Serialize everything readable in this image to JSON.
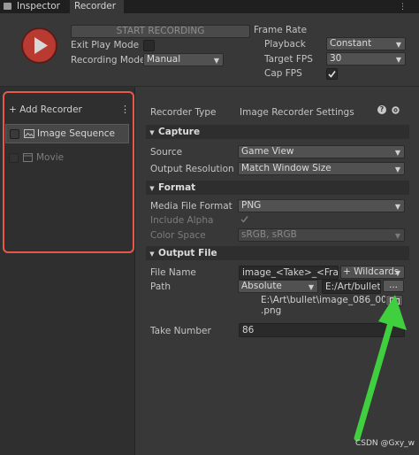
{
  "tabs": [
    {
      "label": "Inspector",
      "active": false
    },
    {
      "label": "Recorder",
      "active": true
    }
  ],
  "top": {
    "start_recording": "START RECORDING",
    "exit_play_mode_label": "Exit Play Mode",
    "recording_mode_label": "Recording Mode",
    "recording_mode_value": "Manual",
    "frame_rate_label": "Frame Rate",
    "playback_label": "Playback",
    "playback_value": "Constant",
    "target_fps_label": "Target FPS",
    "target_fps_value": "30",
    "cap_fps_label": "Cap FPS"
  },
  "left": {
    "add_recorder": "+ Add Recorder",
    "menu_glyph": "⋮",
    "recorders": [
      {
        "label": "Image Sequence",
        "selected": true
      },
      {
        "label": "Movie",
        "selected": false
      }
    ]
  },
  "settings": {
    "recorder_type_label": "Recorder Type",
    "recorder_type_value": "Image Recorder Settings",
    "capture": {
      "title": "Capture",
      "source_label": "Source",
      "source_value": "Game View",
      "output_resolution_label": "Output Resolution",
      "output_resolution_value": "Match Window Size"
    },
    "format": {
      "title": "Format",
      "media_file_format_label": "Media File Format",
      "media_file_format_value": "PNG",
      "include_alpha_label": "Include Alpha",
      "color_space_label": "Color Space",
      "color_space_value": "sRGB, sRGB"
    },
    "output_file": {
      "title": "Output File",
      "file_name_label": "File Name",
      "file_name_value": "image_<Take>_<Frame",
      "wildcards_label": "+ Wildcards",
      "path_label": "Path",
      "path_mode_value": "Absolute",
      "path_value": "E:/Art/bullet",
      "browse_label": "...",
      "output_path_line1": "E:\\Art\\bullet\\image_086_0000",
      "output_path_line2": ".png",
      "take_number_label": "Take Number",
      "take_number_value": "86"
    }
  },
  "watermark": "CSDN @Gxy_w",
  "colors": {
    "highlight_box": "#e8584a",
    "arrow": "#3fcf3f",
    "record_button": "#c0392b"
  }
}
